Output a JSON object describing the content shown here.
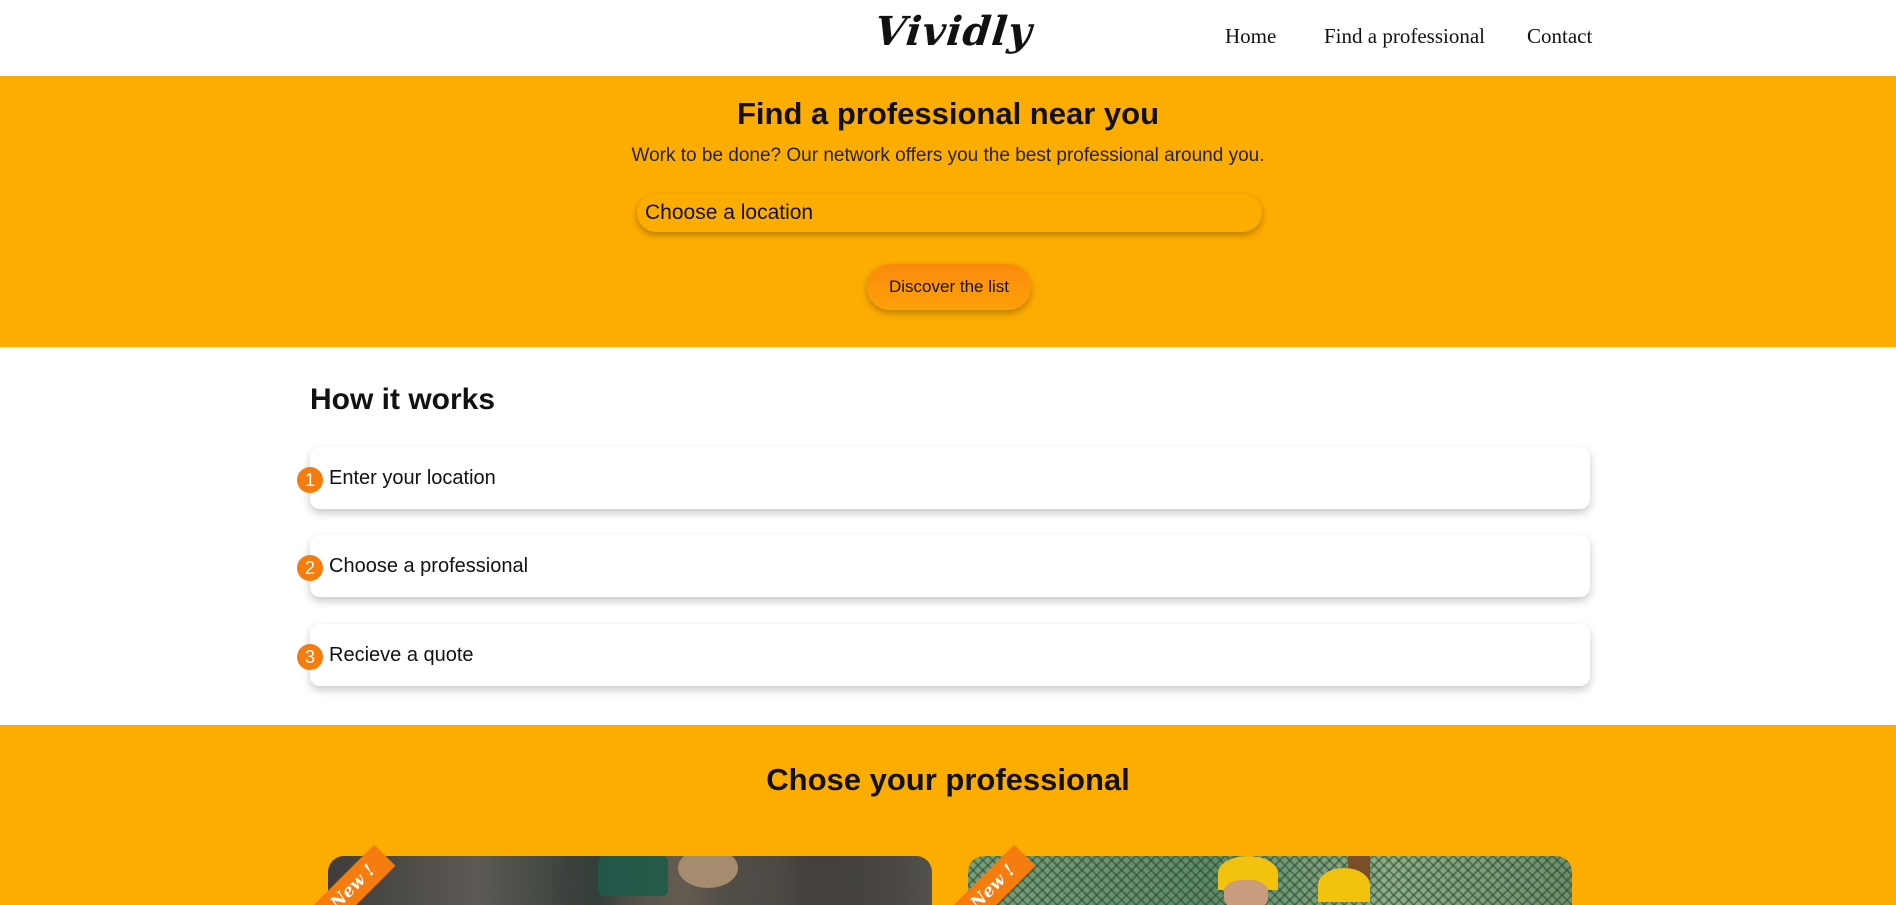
{
  "header": {
    "logo": "Vividly",
    "nav": [
      "Home",
      "Find a professional",
      "Contact"
    ]
  },
  "hero": {
    "title": "Find a professional near you",
    "subtitle": "Work to be done? Our network offers you the best professional around you.",
    "location_placeholder": "Choose a location",
    "button_label": "Discover the list"
  },
  "how": {
    "title": "How it works",
    "steps": [
      {
        "number": "1",
        "label": "Enter your location"
      },
      {
        "number": "2",
        "label": "Choose a professional"
      },
      {
        "number": "3",
        "label": "Recieve a quote"
      }
    ]
  },
  "pros": {
    "title": "Chose your professional",
    "badge": "New !"
  },
  "colors": {
    "accent": "#FDAC01",
    "badge": "#F57C0E",
    "button": "#FB8A0C"
  }
}
